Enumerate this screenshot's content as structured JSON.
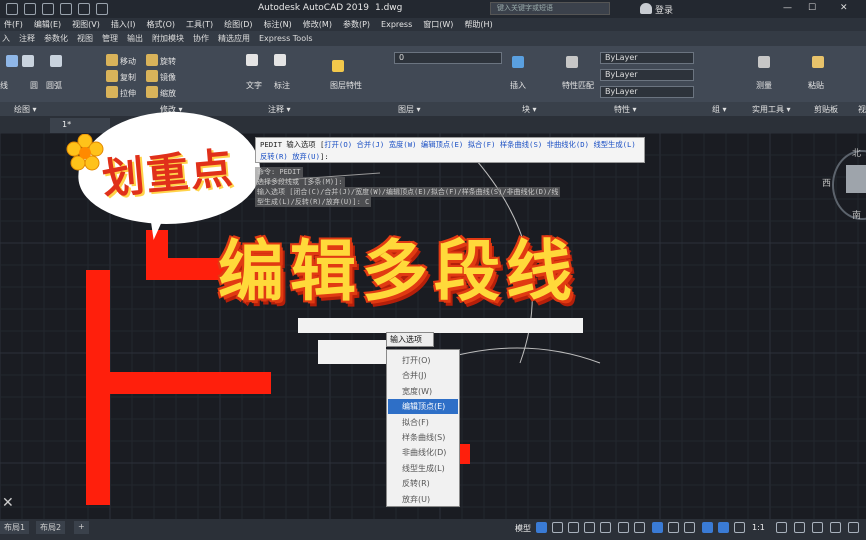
{
  "window": {
    "title": "Autodesk AutoCAD 2019",
    "file": "1.dwg",
    "search_placeholder": "键入关键字或短语",
    "login": "登录"
  },
  "menubar": [
    "件(F)",
    "编辑(E)",
    "视图(V)",
    "插入(I)",
    "格式(O)",
    "工具(T)",
    "绘图(D)",
    "标注(N)",
    "修改(M)",
    "参数(P)",
    "Express",
    "窗口(W)",
    "帮助(H)"
  ],
  "ribbon_tabs": [
    "入",
    "注释",
    "参数化",
    "视图",
    "管理",
    "输出",
    "附加模块",
    "协作",
    "精选应用",
    "Express Tools"
  ],
  "ribbon": {
    "draw_items": [
      "线",
      "圆",
      "圆弧"
    ],
    "modify_items": [
      "移动",
      "旋转",
      "复制",
      "镜像",
      "拉伸",
      "缩放"
    ],
    "text_label": "文字",
    "dim_label": "标注",
    "layer_props": "图层特性",
    "layer_value": "0",
    "insert_label": "插入",
    "match_label": "特性匹配",
    "bylayer": [
      "ByLayer",
      "ByLayer",
      "ByLayer"
    ],
    "measure_label": "测量",
    "paste_label": "粘贴",
    "panels": [
      "绘图 ▾",
      "修改 ▾",
      "注释 ▾",
      "图层 ▾",
      "块 ▾",
      "特性 ▾",
      "组 ▾",
      "实用工具 ▾",
      "剪贴板",
      "视"
    ]
  },
  "doc_tab": "1*",
  "command": {
    "prompt_prefix": "PEDIT 输入选项 [",
    "options": [
      "打开(O)",
      "合并(J)",
      "宽度(W)",
      "编辑顶点(E)",
      "拟合(F)",
      "样条曲线(S)",
      "非曲线化(D)",
      "线型生成(L)",
      "反转(R)",
      "放弃(U)"
    ],
    "prompt_suffix": "]:",
    "history": [
      "命令: PEDIT",
      "选择多段线或 [多条(M)]:",
      "输入选项 [闭合(C)/合并(J)/宽度(W)/编辑顶点(E)/拟合(F)/样条曲线(S)/非曲线化(D)/线",
      "型生成(L)/反转(R)/放弃(U)]: C"
    ]
  },
  "dynamic_input": {
    "label": "输入选项",
    "options": [
      "打开(O)",
      "合并(J)",
      "宽度(W)",
      "编辑顶点(E)",
      "拟合(F)",
      "样条曲线(S)",
      "非曲线化(D)",
      "线型生成(L)",
      "反转(R)",
      "放弃(U)"
    ],
    "selected_index": 3
  },
  "overlay": {
    "bubble_text": "划重点",
    "title": "编辑多段线"
  },
  "compass": {
    "n": "北",
    "w": "西",
    "s": "南"
  },
  "layout_tabs": [
    "布局1",
    "布局2",
    "+"
  ],
  "status": {
    "model": "模型",
    "scale": "1:1"
  },
  "colors": {
    "accent": "#2e6fc7",
    "polyline": "#ff1f0c",
    "title_fill": "#ffd93a"
  }
}
